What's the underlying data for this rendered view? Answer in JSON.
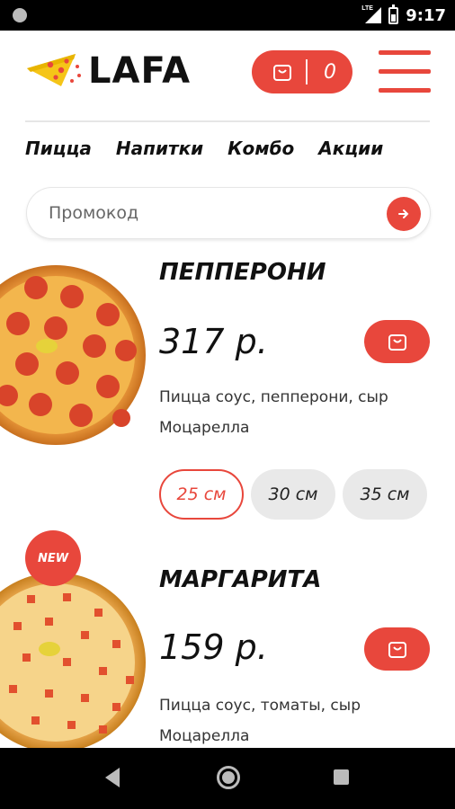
{
  "status_bar": {
    "time": "9:17",
    "network": "LTE"
  },
  "header": {
    "logo_text": "LAFA",
    "cart_count": "0",
    "accent": "#e8473c"
  },
  "nav": [
    "Пицца",
    "Напитки",
    "Комбо",
    "Акции"
  ],
  "promo": {
    "placeholder": "Промокод"
  },
  "products": [
    {
      "name": "ПЕППЕРОНИ",
      "price": "317 р.",
      "description": "Пицца соус, пепперони, сыр Моцарелла",
      "sizes": [
        "25 см",
        "30 см",
        "35 см"
      ],
      "selected_size": "25 см",
      "badge": ""
    },
    {
      "name": "МАРГАРИТА",
      "price": "159 р.",
      "description": "Пицца соус, томаты, сыр Моцарелла",
      "badge": "NEW"
    }
  ],
  "icons": {
    "cart": "shopping-bag-icon",
    "menu": "hamburger-icon",
    "promo_submit": "arrow-right-icon"
  }
}
